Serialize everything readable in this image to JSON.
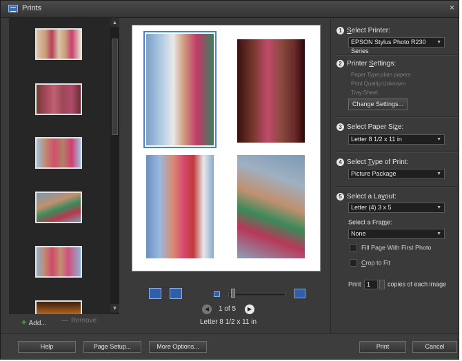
{
  "window": {
    "title": "Prints",
    "close_glyph": "×"
  },
  "thumbnails": [
    {
      "name": "photo-1"
    },
    {
      "name": "photo-2"
    },
    {
      "name": "photo-3"
    },
    {
      "name": "photo-4"
    },
    {
      "name": "photo-5"
    },
    {
      "name": "photo-6"
    }
  ],
  "left_actions": {
    "add_label": "Add...",
    "remove_label": "Remove"
  },
  "preview": {
    "page_indicator": "1 of 5",
    "paper_size_label": "Letter 8 1/2 x 11 in",
    "zoom_level": 0.05
  },
  "settings": {
    "step1": {
      "num": "1",
      "label_pre": "",
      "label_key": "S",
      "label_post": "elect Printer:",
      "value": "EPSON Stylus Photo R230 Series"
    },
    "step2": {
      "num": "2",
      "label_pre": "Printer ",
      "label_key": "S",
      "label_post": "ettings:",
      "lines": [
        "Paper Type:plain papers",
        "Print Quality:Unknown",
        "Tray:Sheet"
      ],
      "button": "Change Settings..."
    },
    "step3": {
      "num": "3",
      "label_pre": "Select Paper Si",
      "label_key": "z",
      "label_post": "e:",
      "value": "Letter 8 1/2 x 11 in"
    },
    "step4": {
      "num": "4",
      "label_pre": "Select ",
      "label_key": "T",
      "label_post": "ype of Print:",
      "value": "Picture Package"
    },
    "step5": {
      "num": "5",
      "label_pre": "Select a La",
      "label_key": "y",
      "label_post": "out:",
      "value": "Letter (4) 3 x 5",
      "frame_label_pre": "Select a Fra",
      "frame_label_key": "m",
      "frame_label_post": "e:",
      "frame_value": "None",
      "fill_page": "Fill Page With First Photo",
      "crop_key": "C",
      "crop_rest": "rop to Fit"
    },
    "copies": {
      "pre": "Print",
      "value": "1",
      "post": "copies of each image"
    }
  },
  "bottom": {
    "help": "Help",
    "page_setup": "Page Setup...",
    "more_options": "More Options...",
    "print": "Print",
    "cancel": "Cancel"
  },
  "icons": {
    "add": "plus-icon",
    "remove": "minus-icon",
    "arrow": "chevron-down-icon"
  },
  "colors": {
    "accent": "#4a7fd1",
    "add_green": "#49b04a"
  }
}
